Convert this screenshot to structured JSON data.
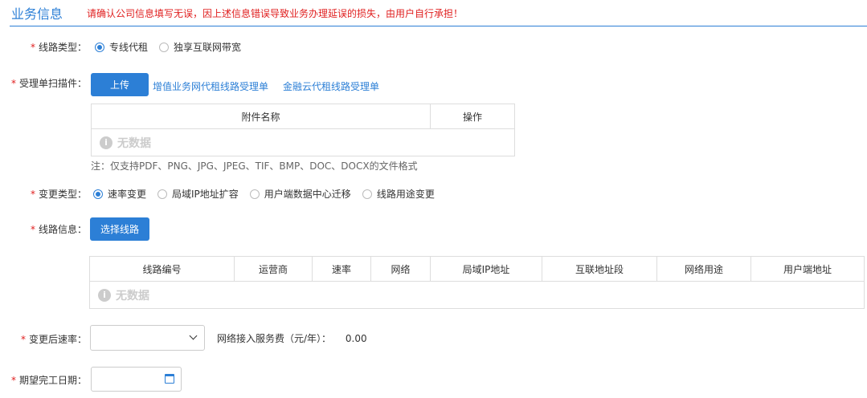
{
  "header": {
    "title": "业务信息",
    "warning": "请确认公司信息填写无误，因上述信息错误导致业务办理延误的损失，由用户自行承担！"
  },
  "line_type": {
    "label": "线路类型：",
    "options": [
      "专线代租",
      "独享互联网带宽"
    ],
    "selected": "专线代租"
  },
  "scan": {
    "label": "受理单扫描件：",
    "upload_label": "上传",
    "links": [
      "增值业务网代租线路受理单",
      "金融云代租线路受理单"
    ],
    "table_headers": [
      "附件名称",
      "操作"
    ],
    "no_data": "无数据",
    "note": "注：仅支持PDF、PNG、JPG、JPEG、TIF、BMP、DOC、DOCX的文件格式"
  },
  "change_type": {
    "label": "变更类型：",
    "options": [
      "速率变更",
      "局域IP地址扩容",
      "用户端数据中心迁移",
      "线路用途变更"
    ],
    "selected": "速率变更"
  },
  "line_info": {
    "label": "线路信息：",
    "select_label": "选择线路",
    "table_headers": [
      "线路编号",
      "运营商",
      "速率",
      "网络",
      "局域IP地址",
      "互联地址段",
      "网络用途",
      "用户端地址"
    ],
    "no_data": "无数据"
  },
  "rate": {
    "label": "变更后速率：",
    "value": "",
    "fee_label": "网络接入服务费（元/年）：",
    "fee_value": "0.00"
  },
  "date": {
    "label": "期望完工日期：",
    "value": ""
  },
  "required_mark": "*",
  "info_glyph": "i",
  "colors": {
    "accent": "#2c7fd6",
    "required": "#e02020"
  }
}
